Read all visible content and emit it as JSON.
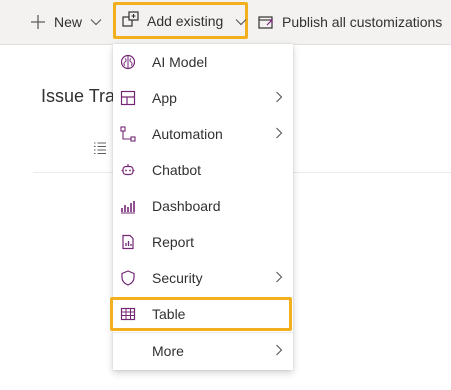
{
  "toolbar": {
    "new_label": "New",
    "add_existing_label": "Add existing",
    "publish_label": "Publish all customizations"
  },
  "page": {
    "title": "Issue Trac"
  },
  "menu": {
    "items": [
      {
        "label": "AI Model",
        "icon": "ai-model-icon",
        "submenu": false
      },
      {
        "label": "App",
        "icon": "app-icon",
        "submenu": true
      },
      {
        "label": "Automation",
        "icon": "automation-icon",
        "submenu": true
      },
      {
        "label": "Chatbot",
        "icon": "chatbot-icon",
        "submenu": false
      },
      {
        "label": "Dashboard",
        "icon": "dashboard-icon",
        "submenu": false
      },
      {
        "label": "Report",
        "icon": "report-icon",
        "submenu": false
      },
      {
        "label": "Security",
        "icon": "security-icon",
        "submenu": true
      },
      {
        "label": "Table",
        "icon": "table-icon",
        "submenu": false,
        "highlighted": true
      },
      {
        "label": "More",
        "icon": "",
        "submenu": true
      }
    ]
  },
  "colors": {
    "highlight_border": "#f2b01e",
    "icon_accent": "#742774",
    "toolbar_bg": "#f3f2f1"
  }
}
